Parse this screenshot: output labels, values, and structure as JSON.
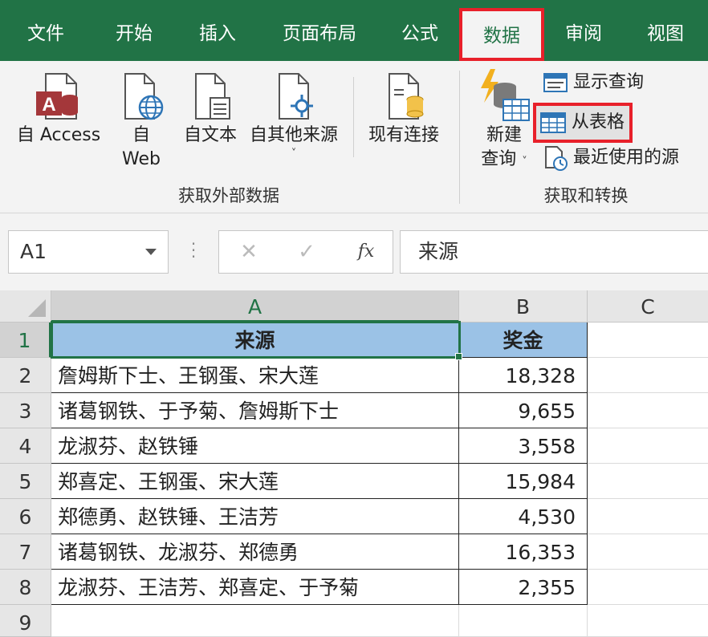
{
  "tabs": [
    {
      "label": "文件",
      "active": false
    },
    {
      "label": "开始",
      "active": false
    },
    {
      "label": "插入",
      "active": false
    },
    {
      "label": "页面布局",
      "active": false
    },
    {
      "label": "公式",
      "active": false
    },
    {
      "label": "数据",
      "active": true
    },
    {
      "label": "审阅",
      "active": false
    },
    {
      "label": "视图",
      "active": false
    }
  ],
  "ribbon": {
    "get_external": {
      "label": "获取外部数据",
      "access": "自 Access",
      "web_line1": "自",
      "web_line2": "Web",
      "text": "自文本",
      "other": "自其他来源",
      "other_caret": "˅",
      "existing": "现有连接"
    },
    "get_transform": {
      "label": "获取和转换",
      "new_query_line1": "新建",
      "new_query_line2": "查询",
      "new_query_caret": "˅",
      "show_queries": "显示查询",
      "from_table": "从表格",
      "recent_sources": "最近使用的源"
    }
  },
  "formula_bar": {
    "name_box": "A1",
    "cancel_glyph": "✕",
    "enter_glyph": "✓",
    "fx_label": "fx",
    "formula": "来源"
  },
  "sheet": {
    "columns": [
      "A",
      "B",
      "C"
    ],
    "rows": [
      "1",
      "2",
      "3",
      "4",
      "5",
      "6",
      "7",
      "8",
      "9"
    ],
    "header": [
      "来源",
      "奖金"
    ],
    "data": [
      [
        "詹姆斯下士、王钢蛋、宋大莲",
        "18,328"
      ],
      [
        "诸葛钢铁、于予菊、詹姆斯下士",
        "9,655"
      ],
      [
        "龙淑芬、赵铁锤",
        "3,558"
      ],
      [
        "郑喜定、王钢蛋、宋大莲",
        "15,984"
      ],
      [
        "郑德勇、赵铁锤、王洁芳",
        "4,530"
      ],
      [
        "诸葛钢铁、龙淑芬、郑德勇",
        "16,353"
      ],
      [
        "龙淑芬、王洁芳、郑喜定、于予菊",
        "2,355"
      ]
    ]
  },
  "colors": {
    "excel_green": "#217346",
    "highlight_red": "#e8202a",
    "header_fill": "#9bc2e6"
  }
}
